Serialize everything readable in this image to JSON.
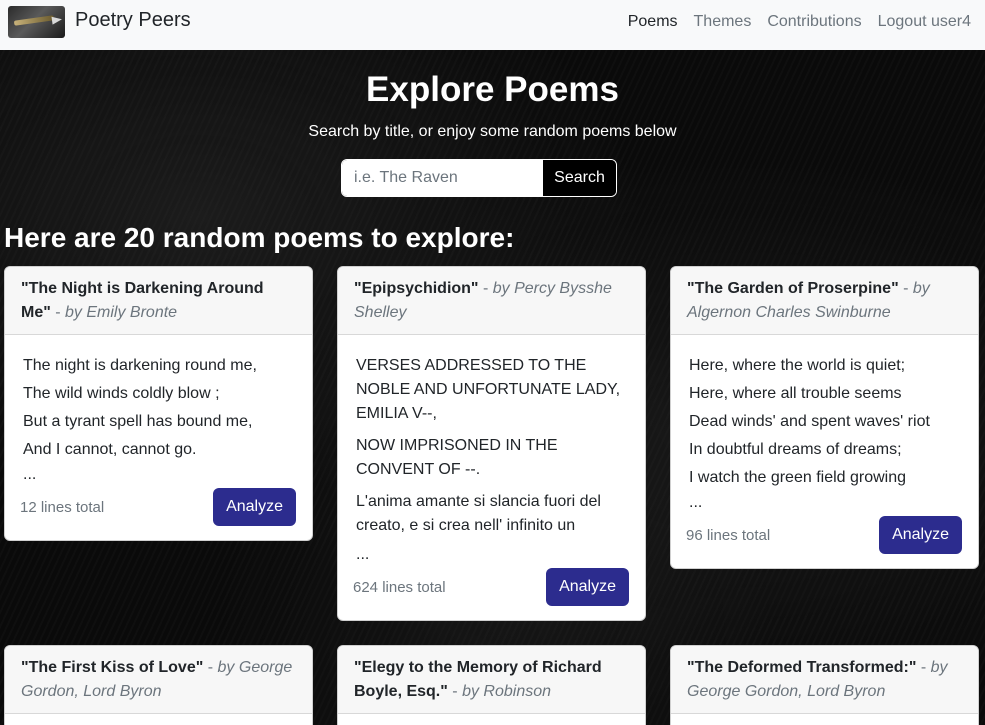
{
  "nav": {
    "brand": "Poetry Peers",
    "links": [
      "Poems",
      "Themes",
      "Contributions",
      "Logout user4"
    ]
  },
  "hero": {
    "title": "Explore Poems",
    "subtitle": "Search by title, or enjoy some random poems below",
    "search_placeholder": "i.e. The Raven",
    "search_button": "Search"
  },
  "section_heading": "Here are 20 random poems to explore:",
  "poems": [
    {
      "title": "\"The Night is Darkening Around Me\"",
      "sep": " - ",
      "author": "by Emily Bronte",
      "lines": [
        "The night is darkening round me,",
        "The wild winds coldly blow ;",
        "But a tyrant spell has bound me,",
        "And I cannot, cannot go."
      ],
      "ellipsis": "...",
      "total": "12 lines total",
      "button": "Analyze"
    },
    {
      "title": "\"Epipsychidion\"",
      "sep": " - ",
      "author": "by Percy Bysshe Shelley",
      "lines": [
        "VERSES ADDRESSED TO THE NOBLE AND UNFORTUNATE LADY, EMILIA V--,",
        "NOW IMPRISONED IN THE CONVENT OF --.",
        "L'anima amante si slancia fuori del creato, e si crea nell' infinito un"
      ],
      "ellipsis": "...",
      "total": "624 lines total",
      "button": "Analyze"
    },
    {
      "title": "\"The Garden of Proserpine\"",
      "sep": " - ",
      "author": "by Algernon Charles Swinburne",
      "lines": [
        "Here, where the world is quiet;",
        "Here, where all trouble seems",
        "Dead winds' and spent waves' riot",
        "In doubtful dreams of dreams;",
        "I watch the green field growing"
      ],
      "ellipsis": "...",
      "total": "96 lines total",
      "button": "Analyze"
    },
    {
      "title": "\"The First Kiss of Love\"",
      "sep": " - ",
      "author": "by George Gordon, Lord Byron"
    },
    {
      "title": "\"Elegy to the Memory of Richard Boyle, Esq.\"",
      "sep": " - ",
      "author": "by Robinson"
    },
    {
      "title": "\"The Deformed Transformed:\"",
      "sep": " - ",
      "author": "by George Gordon, Lord Byron"
    }
  ]
}
